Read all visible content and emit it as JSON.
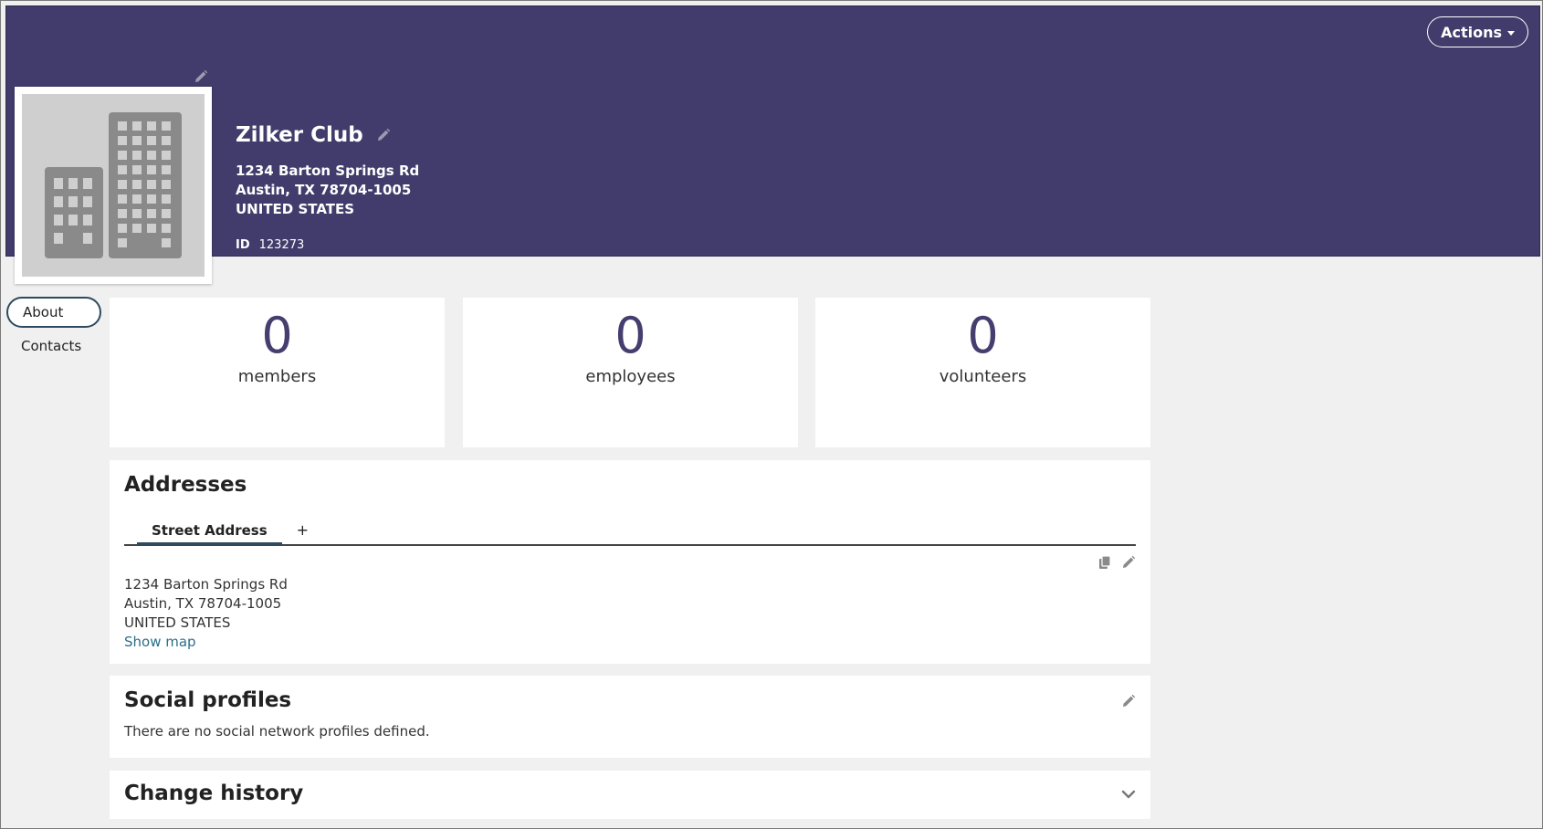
{
  "header": {
    "actions_label": "Actions",
    "org_name": "Zilker Club",
    "address_lines": [
      "1234 Barton Springs Rd",
      "Austin, TX 78704-1005",
      "UNITED STATES"
    ],
    "id_label": "ID",
    "id_value": "123273",
    "background_color": "#413c6b"
  },
  "nav": {
    "items": [
      {
        "label": "About",
        "active": true
      },
      {
        "label": "Contacts",
        "active": false
      }
    ]
  },
  "stats": [
    {
      "value": "0",
      "label": "members"
    },
    {
      "value": "0",
      "label": "employees"
    },
    {
      "value": "0",
      "label": "volunteers"
    }
  ],
  "addresses": {
    "title": "Addresses",
    "tabs": [
      {
        "label": "Street Address",
        "active": true
      }
    ],
    "add_tab_label": "+",
    "lines": [
      "1234 Barton Springs Rd",
      "Austin, TX 78704-1005",
      "UNITED STATES"
    ],
    "show_map_label": "Show map"
  },
  "social": {
    "title": "Social profiles",
    "empty_message": "There are no social network profiles defined."
  },
  "history": {
    "title": "Change history"
  },
  "icons": {
    "edit": "pencil-icon",
    "copy": "copy-icon",
    "expand": "chevron-down-icon",
    "org_placeholder": "building-icon"
  }
}
